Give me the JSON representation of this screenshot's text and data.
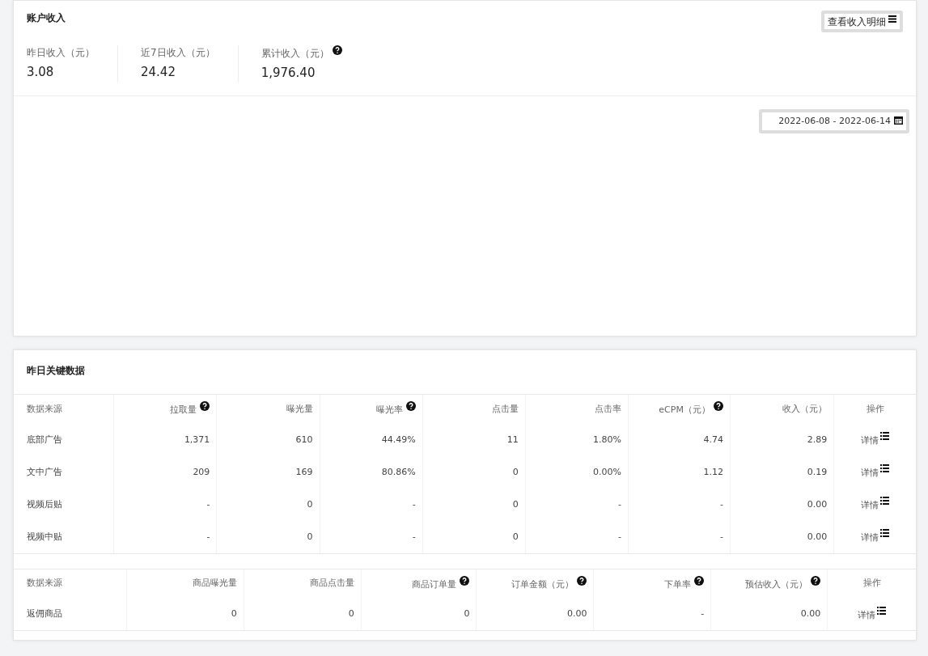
{
  "income_card": {
    "title": "账户收入",
    "detail_button": "查看收入明细",
    "stats": [
      {
        "label": "昨日收入（元）",
        "value": "3.08",
        "help": false
      },
      {
        "label": "近7日收入（元）",
        "value": "24.42",
        "help": false
      },
      {
        "label": "累计收入（元）",
        "value": "1,976.40",
        "help": true
      }
    ],
    "date_range": "2022-06-08 - 2022-06-14"
  },
  "key_data_card": {
    "title": "昨日关键数据",
    "ad_table": {
      "columns": [
        {
          "label": "数据来源",
          "help": false
        },
        {
          "label": "拉取量",
          "help": true
        },
        {
          "label": "曝光量",
          "help": false
        },
        {
          "label": "曝光率",
          "help": true
        },
        {
          "label": "点击量",
          "help": false
        },
        {
          "label": "点击率",
          "help": false
        },
        {
          "label": "eCPM（元）",
          "help": true
        },
        {
          "label": "收入（元）",
          "help": false
        },
        {
          "label": "操作",
          "help": false
        }
      ],
      "rows": [
        {
          "cells": [
            "底部广告",
            "1,371",
            "610",
            "44.49%",
            "11",
            "1.80%",
            "4.74",
            "2.89"
          ],
          "action": "详情"
        },
        {
          "cells": [
            "文中广告",
            "209",
            "169",
            "80.86%",
            "0",
            "0.00%",
            "1.12",
            "0.19"
          ],
          "action": "详情"
        },
        {
          "cells": [
            "视频后贴",
            "-",
            "0",
            "-",
            "0",
            "-",
            "-",
            "0.00"
          ],
          "action": "详情"
        },
        {
          "cells": [
            "视频中贴",
            "-",
            "0",
            "-",
            "0",
            "-",
            "-",
            "0.00"
          ],
          "action": "详情"
        }
      ]
    },
    "product_table": {
      "columns": [
        {
          "label": "数据来源",
          "help": false
        },
        {
          "label": "商品曝光量",
          "help": false
        },
        {
          "label": "商品点击量",
          "help": false
        },
        {
          "label": "商品订单量",
          "help": true
        },
        {
          "label": "订单金额（元）",
          "help": true
        },
        {
          "label": "下单率",
          "help": true
        },
        {
          "label": "预估收入（元）",
          "help": true
        },
        {
          "label": "操作",
          "help": false
        }
      ],
      "rows": [
        {
          "cells": [
            "返佣商品",
            "0",
            "0",
            "0",
            "0.00",
            "-",
            "0.00"
          ],
          "action": "详情"
        }
      ]
    }
  }
}
